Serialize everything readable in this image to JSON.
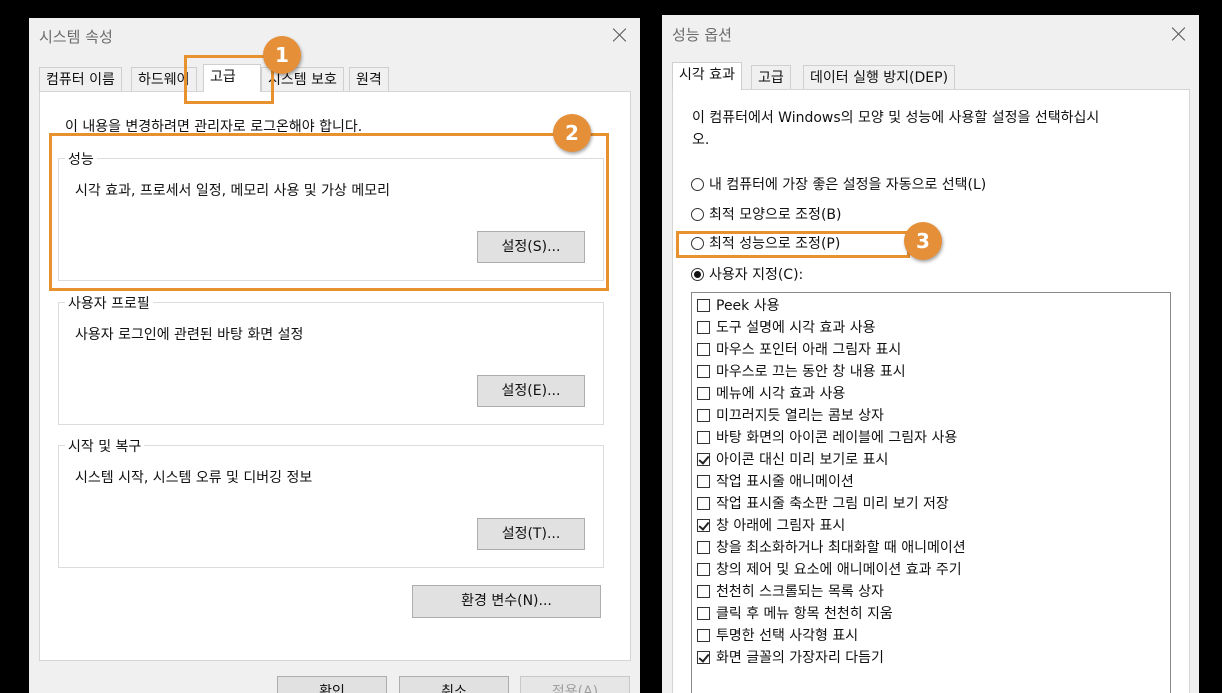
{
  "left_window": {
    "title": "시스템 속성",
    "tabs": [
      {
        "label": "컴퓨터 이름",
        "active": false
      },
      {
        "label": "하드웨어",
        "active": false
      },
      {
        "label": "고급",
        "active": true
      },
      {
        "label": "시스템 보호",
        "active": false
      },
      {
        "label": "원격",
        "active": false
      }
    ],
    "admin_notice": "이 내용을 변경하려면 관리자로 로그온해야 합니다.",
    "groups": [
      {
        "label": "성능",
        "description": "시각 효과, 프로세서 일정, 메모리 사용 및 가상 메모리",
        "button": "설정(S)..."
      },
      {
        "label": "사용자 프로필",
        "description": "사용자 로그인에 관련된 바탕 화면 설정",
        "button": "설정(E)..."
      },
      {
        "label": "시작 및 복구",
        "description": "시스템 시작, 시스템 오류 및 디버깅 정보",
        "button": "설정(T)..."
      }
    ],
    "env_button": "환경 변수(N)...",
    "footer_buttons": [
      "확인",
      "취소",
      "적용(A)"
    ]
  },
  "right_window": {
    "title": "성능 옵션",
    "tabs": [
      {
        "label": "시각 효과",
        "active": true
      },
      {
        "label": "고급",
        "active": false
      },
      {
        "label": "데이터 실행 방지(DEP)",
        "active": false
      }
    ],
    "description_line1": "이 컴퓨터에서 Windows의 모양 및 성능에 사용할 설정을 선택하십시",
    "description_line2": "오.",
    "radios": [
      {
        "label": "내 컴퓨터에 가장 좋은 설정을 자동으로 선택(L)",
        "checked": false
      },
      {
        "label": "최적 모양으로 조정(B)",
        "checked": false
      },
      {
        "label": "최적 성능으로 조정(P)",
        "checked": false
      },
      {
        "label": "사용자 지정(C):",
        "checked": true
      }
    ],
    "options": [
      {
        "label": "Peek 사용",
        "checked": false
      },
      {
        "label": "도구 설명에 시각 효과 사용",
        "checked": false
      },
      {
        "label": "마우스 포인터 아래 그림자 표시",
        "checked": false
      },
      {
        "label": "마우스로 끄는 동안 창 내용 표시",
        "checked": false
      },
      {
        "label": "메뉴에 시각 효과 사용",
        "checked": false
      },
      {
        "label": "미끄러지듯 열리는 콤보 상자",
        "checked": false
      },
      {
        "label": "바탕 화면의 아이콘 레이블에 그림자 사용",
        "checked": false
      },
      {
        "label": "아이콘 대신 미리 보기로 표시",
        "checked": true
      },
      {
        "label": "작업 표시줄 애니메이션",
        "checked": false
      },
      {
        "label": "작업 표시줄 축소판 그림 미리 보기 저장",
        "checked": false
      },
      {
        "label": "창 아래에 그림자 표시",
        "checked": true
      },
      {
        "label": "창을 최소화하거나 최대화할 때 애니메이션",
        "checked": false
      },
      {
        "label": "창의 제어 및 요소에 애니메이션 효과 주기",
        "checked": false
      },
      {
        "label": "천천히 스크롤되는 목록 상자",
        "checked": false
      },
      {
        "label": "클릭 후 메뉴 항목 천천히 지움",
        "checked": false
      },
      {
        "label": "투명한 선택 사각형 표시",
        "checked": false
      },
      {
        "label": "화면 글꼴의 가장자리 다듬기",
        "checked": true
      }
    ]
  },
  "annotations": {
    "badges": [
      "1",
      "2",
      "3"
    ],
    "accent_color": "#e8922f"
  }
}
